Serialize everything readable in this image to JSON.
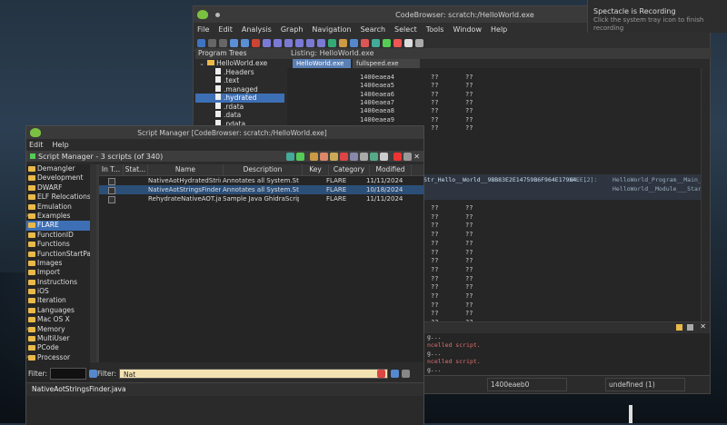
{
  "codebrowser": {
    "title": "CodeBrowser: scratch:/HelloWorld.exe",
    "menu": [
      "File",
      "Edit",
      "Analysis",
      "Graph",
      "Navigation",
      "Search",
      "Select",
      "Tools",
      "Window",
      "Help"
    ],
    "program_trees_title": "Program Trees",
    "tree_root": "HelloWorld.exe",
    "tree_items": [
      ".Headers",
      ".text",
      ".managed",
      ".hydrated",
      ".rdata",
      ".data",
      ".pdata"
    ],
    "tree_selected_index": 3,
    "listing_title": "Listing: HelloWorld.exe",
    "tab_active": "HelloWorld.exe",
    "tab_other": "fullspeed.exe",
    "listing_rows": [
      {
        "addr": "1400eaea4",
        "v1": "??",
        "v2": "??"
      },
      {
        "addr": "1400eaea5",
        "v1": "??",
        "v2": "??"
      },
      {
        "addr": "1400eaea6",
        "v1": "??",
        "v2": "??"
      },
      {
        "addr": "1400eaea7",
        "v1": "??",
        "v2": "??"
      },
      {
        "addr": "1400eaea8",
        "v1": "??",
        "v2": "??"
      },
      {
        "addr": "1400eaea9",
        "v1": "??",
        "v2": "??"
      },
      {
        "addr": "1400eaeaa",
        "v1": "??",
        "v2": "??"
      }
    ],
    "lower_rows": [
      {
        "v1": "??",
        "v2": "??"
      },
      {
        "v1": "??",
        "v2": "??"
      },
      {
        "v1": "??",
        "v2": "??"
      },
      {
        "v1": "??",
        "v2": "??"
      },
      {
        "v1": "??",
        "v2": "??"
      },
      {
        "v1": "??",
        "v2": "??"
      },
      {
        "v1": "??",
        "v2": "??"
      },
      {
        "v1": "??",
        "v2": "??"
      },
      {
        "v1": "??",
        "v2": "??"
      },
      {
        "v1": "??",
        "v2": "??"
      },
      {
        "v1": "??",
        "v2": "??"
      },
      {
        "v1": "??",
        "v2": "??"
      },
      {
        "v1": "??",
        "v2": "??"
      },
      {
        "v1": "??",
        "v2": "??"
      }
    ],
    "string_line": "Str_Hello__World__9BB83E2E14759B6F964E17964...",
    "xref": "XREF[2]:",
    "xref_target1": "HelloWorld_Program__Main_",
    "xref_target2": "HelloWorld__Module___Startu",
    "console_lines": [
      "g...",
      "ncelled script.",
      "g...",
      "ncelled script.",
      "g..."
    ],
    "status_addr": "1400eaeb0",
    "status_value": "undefined (1)"
  },
  "notification": {
    "title": "Spectacle is Recording",
    "body1": "Click the system tray icon to finish",
    "body2": "recording"
  },
  "script_manager": {
    "title": "Script Manager [CodeBrowser: scratch:/HelloWorld.exe]",
    "menu": [
      "Edit",
      "Help"
    ],
    "header_label": "Script Manager - 3 scripts  (of 340)",
    "categories": [
      "Demangler",
      "Development",
      "DWARF",
      "ELF Relocations",
      "Emulation",
      "Examples",
      "FLARE",
      "FunctionID",
      "Functions",
      "FunctionStartPa",
      "Images",
      "Import",
      "Instructions",
      "iOS",
      "Iteration",
      "Languages",
      "Mac OS X",
      "Memory",
      "MultiUser",
      "PCode",
      "Processor"
    ],
    "categories_expandable": [
      5,
      17,
      20
    ],
    "selected_category_index": 6,
    "columns": [
      "In T...",
      "Stat...",
      "Name",
      "Description",
      "Key",
      "Category",
      "Modified"
    ],
    "rows": [
      {
        "name": "NativeAotHydratedString...",
        "description": "Annotates all System.Stri...",
        "key": "",
        "category": "FLARE",
        "modified": "11/11/2024"
      },
      {
        "name": "NativeAotStringsFinder.j...",
        "description": "Annotates all System.Stri...",
        "key": "",
        "category": "FLARE",
        "modified": "10/18/2024"
      },
      {
        "name": "RehydrateNativeAOT.java",
        "description": "Sample Java GhidraScript",
        "key": "",
        "category": "FLARE",
        "modified": "11/11/2024"
      }
    ],
    "selected_row_index": 1,
    "filter_label_left": "Filter:",
    "filter_label_right": "Filter:",
    "filter_value": "Nat",
    "selected_script": "NativeAotStringsFinder.java"
  }
}
